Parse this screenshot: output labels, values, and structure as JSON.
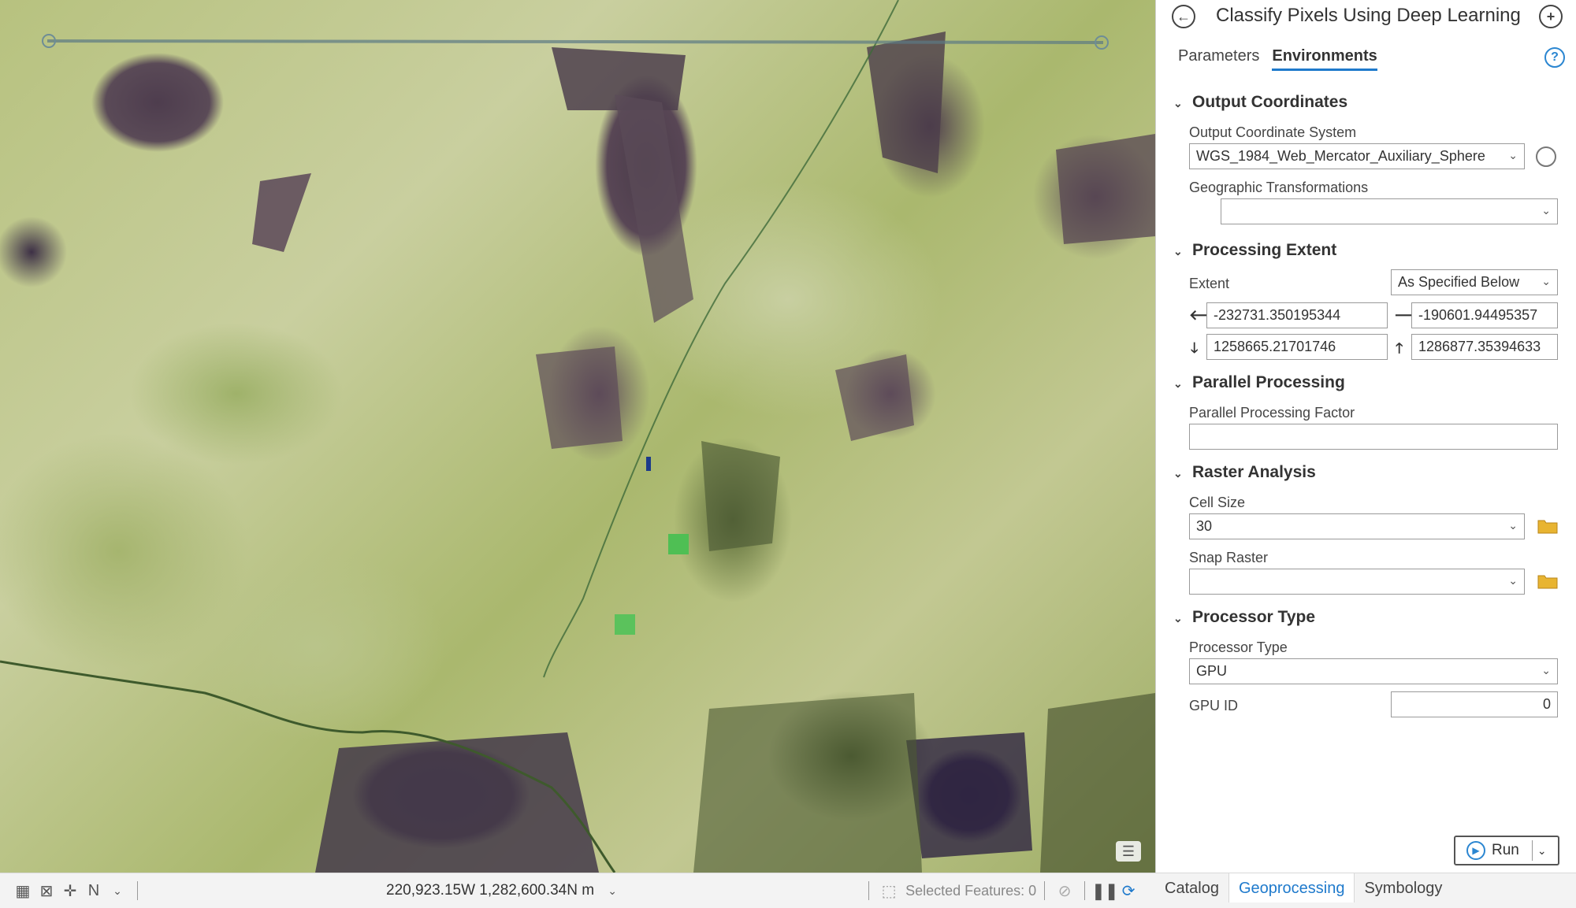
{
  "map": {
    "status": {
      "coordinates": "220,923.15W 1,282,600.34N m",
      "selected_features": "Selected Features: 0"
    }
  },
  "panel": {
    "title": "Classify Pixels Using Deep Learning",
    "tabs": [
      "Parameters",
      "Environments"
    ],
    "active_tab": "Environments",
    "sections": {
      "output_coordinates": {
        "header": "Output Coordinates",
        "ocs_label": "Output Coordinate System",
        "ocs_value": "WGS_1984_Web_Mercator_Auxiliary_Sphere",
        "geo_label": "Geographic Transformations",
        "geo_value": ""
      },
      "processing_extent": {
        "header": "Processing Extent",
        "extent_label": "Extent",
        "extent_value": "As Specified Below",
        "left": "-232731.350195344",
        "right": "-190601.94495357",
        "bottom": "1258665.21701746",
        "top": "1286877.35394633"
      },
      "parallel_processing": {
        "header": "Parallel Processing",
        "factor_label": "Parallel Processing Factor",
        "factor_value": ""
      },
      "raster_analysis": {
        "header": "Raster Analysis",
        "cell_size_label": "Cell Size",
        "cell_size_value": "30",
        "snap_raster_label": "Snap Raster",
        "snap_raster_value": ""
      },
      "processor_type": {
        "header": "Processor Type",
        "type_label": "Processor Type",
        "type_value": "GPU",
        "gpu_id_label": "GPU ID",
        "gpu_id_value": "0"
      }
    },
    "run_label": "Run"
  },
  "bottom_tabs": [
    "Catalog",
    "Geoprocessing",
    "Symbology"
  ],
  "active_bottom_tab": "Geoprocessing",
  "colors": {
    "accent": "#1f7acc",
    "folder": "#e8b431"
  },
  "icons": [
    "back-icon",
    "add-icon",
    "help-icon",
    "globe-icon",
    "folder-icon",
    "play-icon",
    "arrow-left-icon",
    "arrow-right-icon",
    "arrow-down-icon",
    "arrow-up-icon",
    "refresh-icon",
    "pause-icon"
  ]
}
